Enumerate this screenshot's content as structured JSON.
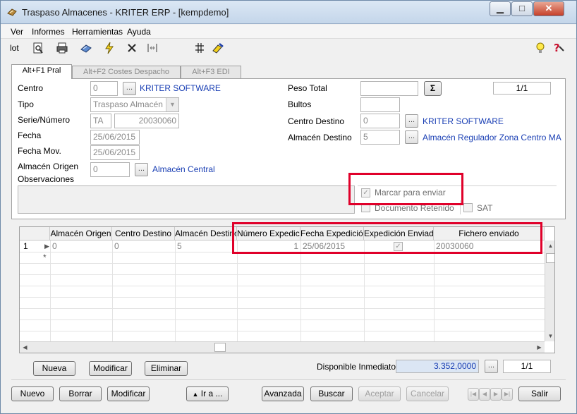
{
  "window": {
    "title": "Traspaso Almacenes - KRITER ERP - [kempdemo]",
    "minimize": "▁",
    "maximize": "□",
    "close": "✕"
  },
  "menu": [
    "Ver",
    "Informes",
    "Herramientas",
    "Ayuda"
  ],
  "toolbar": {
    "lot_label": "lot"
  },
  "tabs": [
    "Alt+F1 Pral",
    "Alt+F2 Costes Despacho",
    "Alt+F3 EDI"
  ],
  "form": {
    "centro_label": "Centro",
    "centro_value": "0",
    "centro_name": "KRITER SOFTWARE",
    "tipo_label": "Tipo",
    "tipo_value": "Traspaso Almacén",
    "serie_label": "Serie/Número",
    "serie_value": "TA",
    "numero_value": "20030060",
    "fecha_label": "Fecha",
    "fecha_value": "25/06/2015",
    "fecha_mov_label": "Fecha Mov.",
    "fecha_mov_value": "25/06/2015",
    "almacen_origen_label": "Almacén Origen",
    "almacen_origen_value": "0",
    "almacen_origen_name": "Almacén Central",
    "observaciones_label": "Observaciones",
    "peso_total_label": "Peso Total",
    "peso_total_value": "",
    "sigma_label": "Σ",
    "page_indicator": "1/1",
    "bultos_label": "Bultos",
    "bultos_value": "",
    "centro_destino_label": "Centro Destino",
    "centro_destino_value": "0",
    "centro_destino_name": "KRITER SOFTWARE",
    "almacen_destino_label": "Almacén Destino",
    "almacen_destino_value": "5",
    "almacen_destino_name": "Almacén Regulador Zona Centro MA",
    "marcar_label": "Marcar para enviar",
    "marcar_checked": "✓",
    "documento_retenido_label": "Documento Retenido",
    "sat_label": "SAT",
    "dots": "..."
  },
  "grid": {
    "columns": [
      "Almacén Origen",
      "Centro Destino",
      "Almacén Destino",
      "Número Expedición",
      "Fecha Expedición",
      "Expedición Enviada",
      "Fichero enviado"
    ],
    "row": {
      "num": "1",
      "almacen_origen": "0",
      "centro_destino": "0",
      "almacen_destino": "5",
      "numero_expedicion": "1",
      "fecha_expedicion": "25/06/2015",
      "expedicion_enviada": "✓",
      "fichero_enviado": "20030060"
    },
    "new_row_marker": "*"
  },
  "grid_buttons": {
    "nueva": "Nueva",
    "modificar": "Modificar",
    "eliminar": "Eliminar"
  },
  "disponible": {
    "label": "Disponible Inmediato",
    "value": "3.352,0000",
    "dots": "...",
    "page": "1/1"
  },
  "bottom_buttons": {
    "nuevo": "Nuevo",
    "borrar": "Borrar",
    "modificar": "Modificar",
    "ir_a": "Ir a ...",
    "avanzada": "Avanzada",
    "buscar": "Buscar",
    "aceptar": "Aceptar",
    "cancelar": "Cancelar",
    "salir": "Salir"
  }
}
